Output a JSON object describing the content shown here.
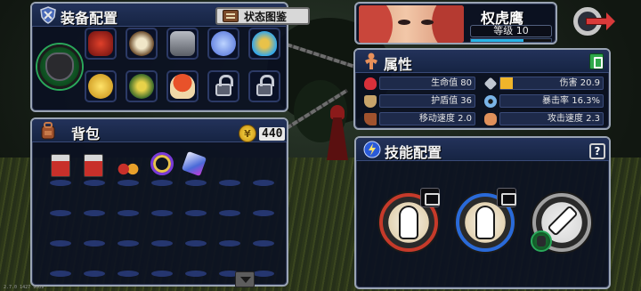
{
  "equipment": {
    "title": "装备配置",
    "status_button": "状态图鉴",
    "main_weapon_icon": "claw-gauntlet-icon",
    "slots": [
      {
        "icon": "red-mask-icon",
        "locked": false
      },
      {
        "icon": "tusk-horn-icon",
        "locked": false
      },
      {
        "icon": "armor-chest-icon",
        "locked": false
      },
      {
        "icon": "magnifier-orb-icon",
        "locked": false
      },
      {
        "icon": "blue-flame-icon",
        "locked": false
      },
      {
        "icon": "golden-claw-icon",
        "locked": false
      },
      {
        "icon": "plant-monster-icon",
        "locked": false
      },
      {
        "icon": "red-mushroom-icon",
        "locked": false
      },
      {
        "icon": "padlock-icon",
        "locked": true
      },
      {
        "icon": "padlock-icon",
        "locked": true
      }
    ]
  },
  "character": {
    "name": "权虎鹰",
    "level_label": "等级 10",
    "exp_progress": 0.65
  },
  "attributes": {
    "title": "属性",
    "stats": [
      {
        "label": "生命值 80",
        "icon": "heart-icon",
        "color": "#d8303a"
      },
      {
        "label": "伤害 20.9",
        "icon": "sword-icon",
        "color": "#c0c6d0",
        "fill": 0.12
      },
      {
        "label": "护盾值 36",
        "icon": "shield-icon",
        "color": "#c8a46a"
      },
      {
        "label": "暴击率 16.3%",
        "icon": "eye-icon",
        "color": "#7ab4e8"
      },
      {
        "label": "移动速度 2.0",
        "icon": "boot-icon",
        "color": "#a0522d"
      },
      {
        "label": "攻击速度 2.3",
        "icon": "fist-icon",
        "color": "#e0905a"
      }
    ]
  },
  "bag": {
    "title": "背包",
    "gold_symbol": "¥",
    "gold": "440",
    "items": [
      {
        "icon": "red-scroll-machine-icon"
      },
      {
        "icon": "red-scroll-machine-icon"
      },
      {
        "icon": "berry-cluster-icon"
      },
      {
        "icon": "purple-star-necklace-icon"
      },
      {
        "icon": "crystal-cube-icon"
      }
    ]
  },
  "skills": {
    "title": "技能配置",
    "help_label": "?",
    "items": [
      {
        "icon": "monk-meditate-icon",
        "ring": "red"
      },
      {
        "icon": "monk-meditate-icon",
        "ring": "blue"
      },
      {
        "icon": "crossed-blades-icon",
        "ring": "grey"
      }
    ]
  },
  "version": "2.7.0 1427 9609"
}
